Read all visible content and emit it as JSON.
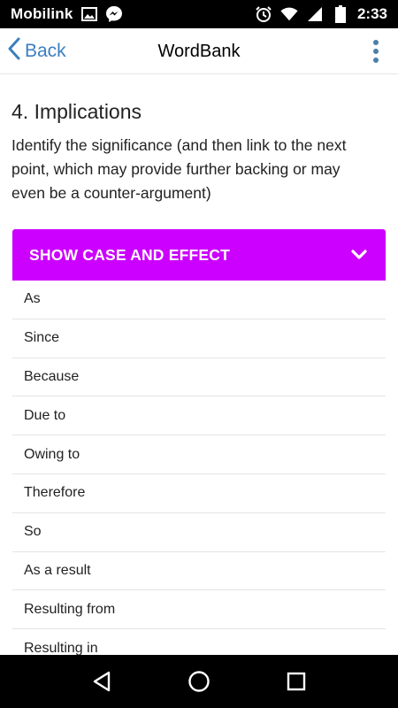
{
  "status_bar": {
    "carrier": "Mobilink",
    "time": "2:33",
    "icons": [
      "gallery-icon",
      "messenger-icon",
      "alarm-icon",
      "wifi-icon",
      "signal-icon",
      "battery-icon"
    ]
  },
  "header": {
    "back_label": "Back",
    "title": "WordBank",
    "menu_icon": "more-vert-icon"
  },
  "section": {
    "title": "4. Implications",
    "description": "Identify the significance (and then link to the next point, which may provide further backing or may even be a counter-argument)"
  },
  "accordion": {
    "label": "SHOW CASE AND EFFECT",
    "color": "#cc00ff",
    "expanded": true,
    "items": [
      "As",
      "Since",
      "Because",
      "Due to",
      "Owing to",
      "Therefore",
      "So",
      "As a result",
      "Resulting from",
      "Resulting in"
    ]
  },
  "nav_bar": {
    "icons": [
      "back-triangle-icon",
      "home-circle-icon",
      "recents-square-icon"
    ]
  },
  "colors": {
    "accent": "#3c7fc0",
    "accordion": "#cc00ff"
  }
}
